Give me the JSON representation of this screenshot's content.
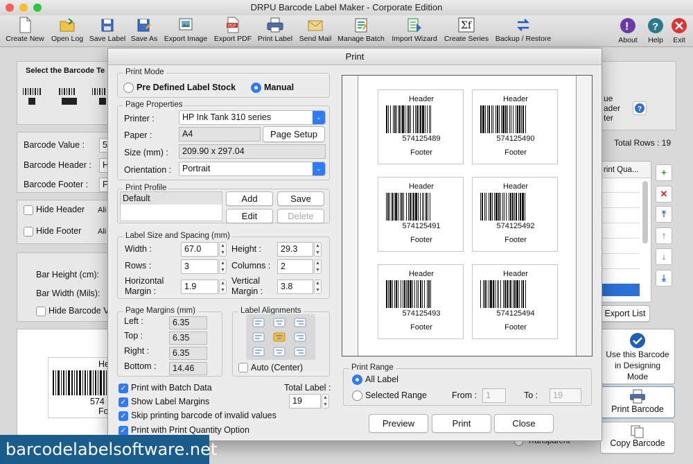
{
  "app": {
    "title": "DRPU Barcode Label Maker - Corporate Edition"
  },
  "toolbar": {
    "items": [
      "Create New",
      "Open Log",
      "Save Label",
      "Save As",
      "Export Image",
      "Export PDF",
      "Print Label",
      "Send Mail",
      "Manage Batch",
      "Import Wizard",
      "Create Series",
      "Backup / Restore"
    ],
    "right": [
      "About",
      "Help",
      "Exit"
    ]
  },
  "background": {
    "select_barcode_type": "Select the Barcode Te",
    "barcode_value_label": "Barcode Value :",
    "barcode_value_text": "5",
    "barcode_header_label": "Barcode Header :",
    "barcode_header_text": "H",
    "barcode_footer_label": "Barcode Footer :",
    "barcode_footer_text": "F",
    "hide_header": "Hide Header",
    "hide_footer": "Hide Footer",
    "align_cut": "Ali",
    "align_cut2": "Ali",
    "bar_height": "Bar Height (cm):",
    "bar_width": "Bar Width (Mils):",
    "hide_barcode": "Hide Barcode V",
    "total_rows": "Total Rows : 19",
    "col_print_qty": "rint Qua...",
    "right_text1": "ue",
    "right_text2": "ader",
    "right_text3": "ter",
    "export_list": "Export List",
    "use_designing": "Use this Barcode in Designing Mode",
    "print_barcode": "Print Barcode",
    "copy_barcode": "Copy Barcode",
    "transparent": "Transparent",
    "preview_header": "He",
    "preview_num": "574",
    "preview_footer": "Fo"
  },
  "dialog": {
    "title": "Print",
    "print_mode": {
      "label": "Print Mode",
      "options": [
        "Pre Defined Label Stock",
        "Manual"
      ],
      "selected": "Manual"
    },
    "page_properties": {
      "label": "Page Properties",
      "printer_label": "Printer :",
      "printer_value": "HP Ink Tank 310 series",
      "paper_label": "Paper :",
      "paper_value": "A4",
      "page_setup": "Page Setup",
      "size_label": "Size (mm) :",
      "size_value": "209.90 x 297.04",
      "orientation_label": "Orientation :",
      "orientation_value": "Portrait"
    },
    "print_profile": {
      "label": "Print Profile",
      "items": [
        "Default"
      ],
      "add": "Add",
      "save": "Save",
      "edit": "Edit",
      "delete": "Delete"
    },
    "label_size": {
      "label": "Label Size and Spacing (mm)",
      "width_label": "Width :",
      "width": "67.0",
      "height_label": "Height :",
      "height": "29.3",
      "rows_label": "Rows :",
      "rows": "3",
      "columns_label": "Columns :",
      "columns": "2",
      "hmargin_label_1": "Horizontal",
      "hmargin_label_2": "Margin :",
      "hmargin": "1.9",
      "vmargin_label_1": "Vertical",
      "vmargin_label_2": "Margin :",
      "vmargin": "3.8"
    },
    "page_margins": {
      "label": "Page Margins (mm)",
      "left_label": "Left :",
      "left": "6.35",
      "top_label": "Top :",
      "top": "6.35",
      "right_label": "Right :",
      "right": "6.35",
      "bottom_label": "Bottom :",
      "bottom": "14.46"
    },
    "label_alignments": {
      "label": "Label Alignments",
      "auto_center": "Auto (Center)"
    },
    "options": {
      "batch": "Print with Batch Data",
      "margins": "Show Label Margins",
      "skip": "Skip printing barcode of invalid values",
      "quantity": "Print with Print Quantity Option"
    },
    "total_label": {
      "label": "Total Label :",
      "value": "19"
    },
    "preview_labels": [
      {
        "header": "Header",
        "number": "574125489",
        "footer": "Footer"
      },
      {
        "header": "Header",
        "number": "574125490",
        "footer": "Footer"
      },
      {
        "header": "Header",
        "number": "574125491",
        "footer": "Footer"
      },
      {
        "header": "Header",
        "number": "574125492",
        "footer": "Footer"
      },
      {
        "header": "Header",
        "number": "574125493",
        "footer": "Footer"
      },
      {
        "header": "Header",
        "number": "574125494",
        "footer": "Footer"
      }
    ],
    "print_range": {
      "label": "Print Range",
      "all": "All Label",
      "selected": "Selected Range",
      "from_label": "From :",
      "from": "1",
      "to_label": "To :",
      "to": "19"
    },
    "buttons": {
      "preview": "Preview",
      "print": "Print",
      "close": "Close"
    }
  },
  "watermark": "barcodelabelsoftware.net",
  "colors": {
    "accent": "#2f7bf6",
    "watermark_bg": "#1a5d8c"
  }
}
